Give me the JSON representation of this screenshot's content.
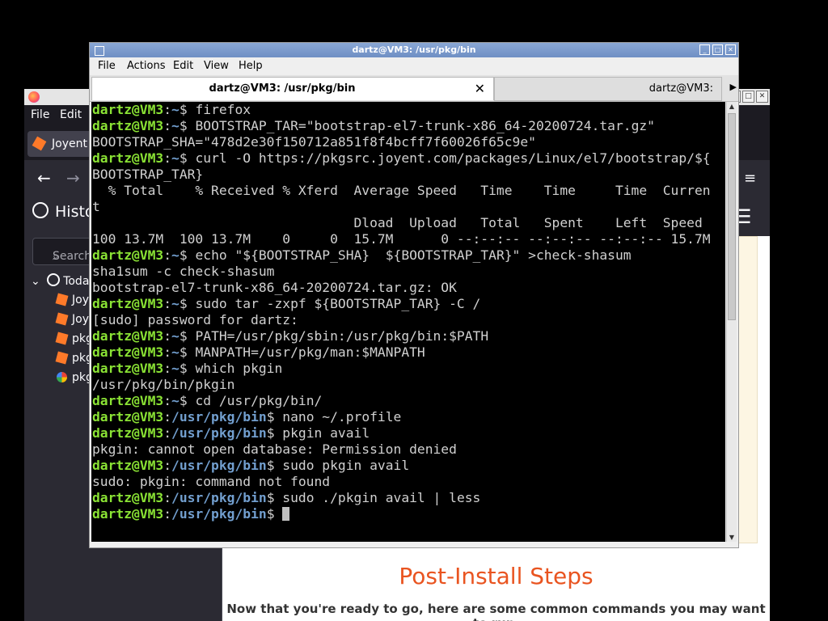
{
  "browser": {
    "menu": [
      "File",
      "Edit"
    ],
    "tab_label": "Joyent",
    "sidebar": {
      "title": "Histo",
      "search_placeholder": "Search",
      "group_label": "Today",
      "items": [
        {
          "label": "Joy",
          "icon": "package-icon"
        },
        {
          "label": "Joy",
          "icon": "package-icon"
        },
        {
          "label": "pkg",
          "icon": "package-icon"
        },
        {
          "label": "pkg",
          "icon": "package-icon"
        },
        {
          "label": "pkg",
          "icon": "google-icon"
        }
      ]
    },
    "content": {
      "heading": "Post-Install Steps",
      "text": "Now that you're ready to go, here are some common commands you may want to run."
    }
  },
  "terminal": {
    "title": "dartz@VM3: /usr/pkg/bin",
    "menu": [
      "File",
      "Actions",
      "Edit",
      "View",
      "Help"
    ],
    "tabs": [
      "dartz@VM3: /usr/pkg/bin",
      "dartz@VM3:"
    ],
    "user": "dartz@VM3",
    "lines": [
      {
        "path": "~",
        "cmd": "firefox"
      },
      {
        "path": "~",
        "cmd": "BOOTSTRAP_TAR=\"bootstrap-el7-trunk-x86_64-20200724.tar.gz\""
      },
      {
        "out": "BOOTSTRAP_SHA=\"478d2e30f150712a851f8f4bcff7f60026f65c9e\""
      },
      {
        "path": "~",
        "cmd": "curl -O https://pkgsrc.joyent.com/packages/Linux/el7/bootstrap/${"
      },
      {
        "out": "BOOTSTRAP_TAR}"
      },
      {
        "out": "  % Total    % Received % Xferd  Average Speed   Time    Time     Time  Curren"
      },
      {
        "out": "t"
      },
      {
        "out": "                                 Dload  Upload   Total   Spent    Left  Speed"
      },
      {
        "out": "100 13.7M  100 13.7M    0     0  15.7M      0 --:--:-- --:--:-- --:--:-- 15.7M"
      },
      {
        "path": "~",
        "cmd": "echo \"${BOOTSTRAP_SHA}  ${BOOTSTRAP_TAR}\" >check-shasum"
      },
      {
        "out": "sha1sum -c check-shasum"
      },
      {
        "out": "bootstrap-el7-trunk-x86_64-20200724.tar.gz: OK"
      },
      {
        "path": "~",
        "cmd": "sudo tar -zxpf ${BOOTSTRAP_TAR} -C /"
      },
      {
        "out": "[sudo] password for dartz:"
      },
      {
        "path": "~",
        "cmd": "PATH=/usr/pkg/sbin:/usr/pkg/bin:$PATH"
      },
      {
        "path": "~",
        "cmd": "MANPATH=/usr/pkg/man:$MANPATH"
      },
      {
        "path": "~",
        "cmd": "which pkgin"
      },
      {
        "out": "/usr/pkg/bin/pkgin"
      },
      {
        "path": "~",
        "cmd": "cd /usr/pkg/bin/"
      },
      {
        "path": "/usr/pkg/bin",
        "cmd": "nano ~/.profile"
      },
      {
        "path": "/usr/pkg/bin",
        "cmd": "pkgin avail"
      },
      {
        "out": "pkgin: cannot open database: Permission denied"
      },
      {
        "path": "/usr/pkg/bin",
        "cmd": "sudo pkgin avail"
      },
      {
        "out": "sudo: pkgin: command not found"
      },
      {
        "path": "/usr/pkg/bin",
        "cmd": "sudo ./pkgin avail | less"
      },
      {
        "path": "/usr/pkg/bin",
        "cmd": "",
        "cursor": true
      }
    ]
  }
}
